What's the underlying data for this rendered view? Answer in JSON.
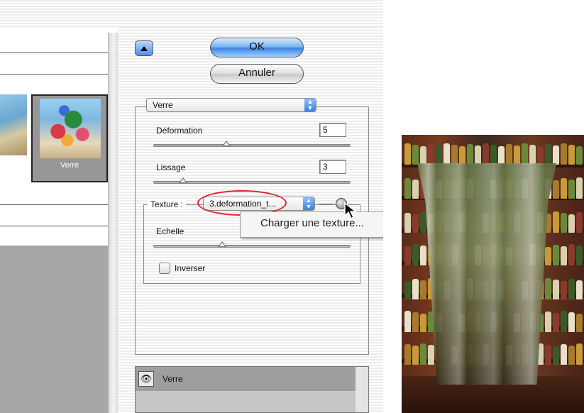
{
  "dialog": {
    "ok_label": "OK",
    "cancel_label": "Annuler",
    "collapse_icon": "triangle-up-icon"
  },
  "thumbnail": {
    "caption": "Verre"
  },
  "filter": {
    "selected": "Verre",
    "deformation": {
      "label": "Déformation",
      "value": "5",
      "level": 0.37
    },
    "lissage": {
      "label": "Lissage",
      "value": "3",
      "level": 0.15
    },
    "texture": {
      "label": "Texture :",
      "selected": "3.deformation_t...",
      "menu_item": "Charger une texture..."
    },
    "echelle": {
      "label": "Echelle",
      "level": 0.35
    },
    "inverser": {
      "label": "Inverser",
      "checked": false
    }
  },
  "history": {
    "row_label": "Verre"
  },
  "colors": {
    "accent_blue": "#3f86e0",
    "highlight_red": "#e0202a"
  }
}
